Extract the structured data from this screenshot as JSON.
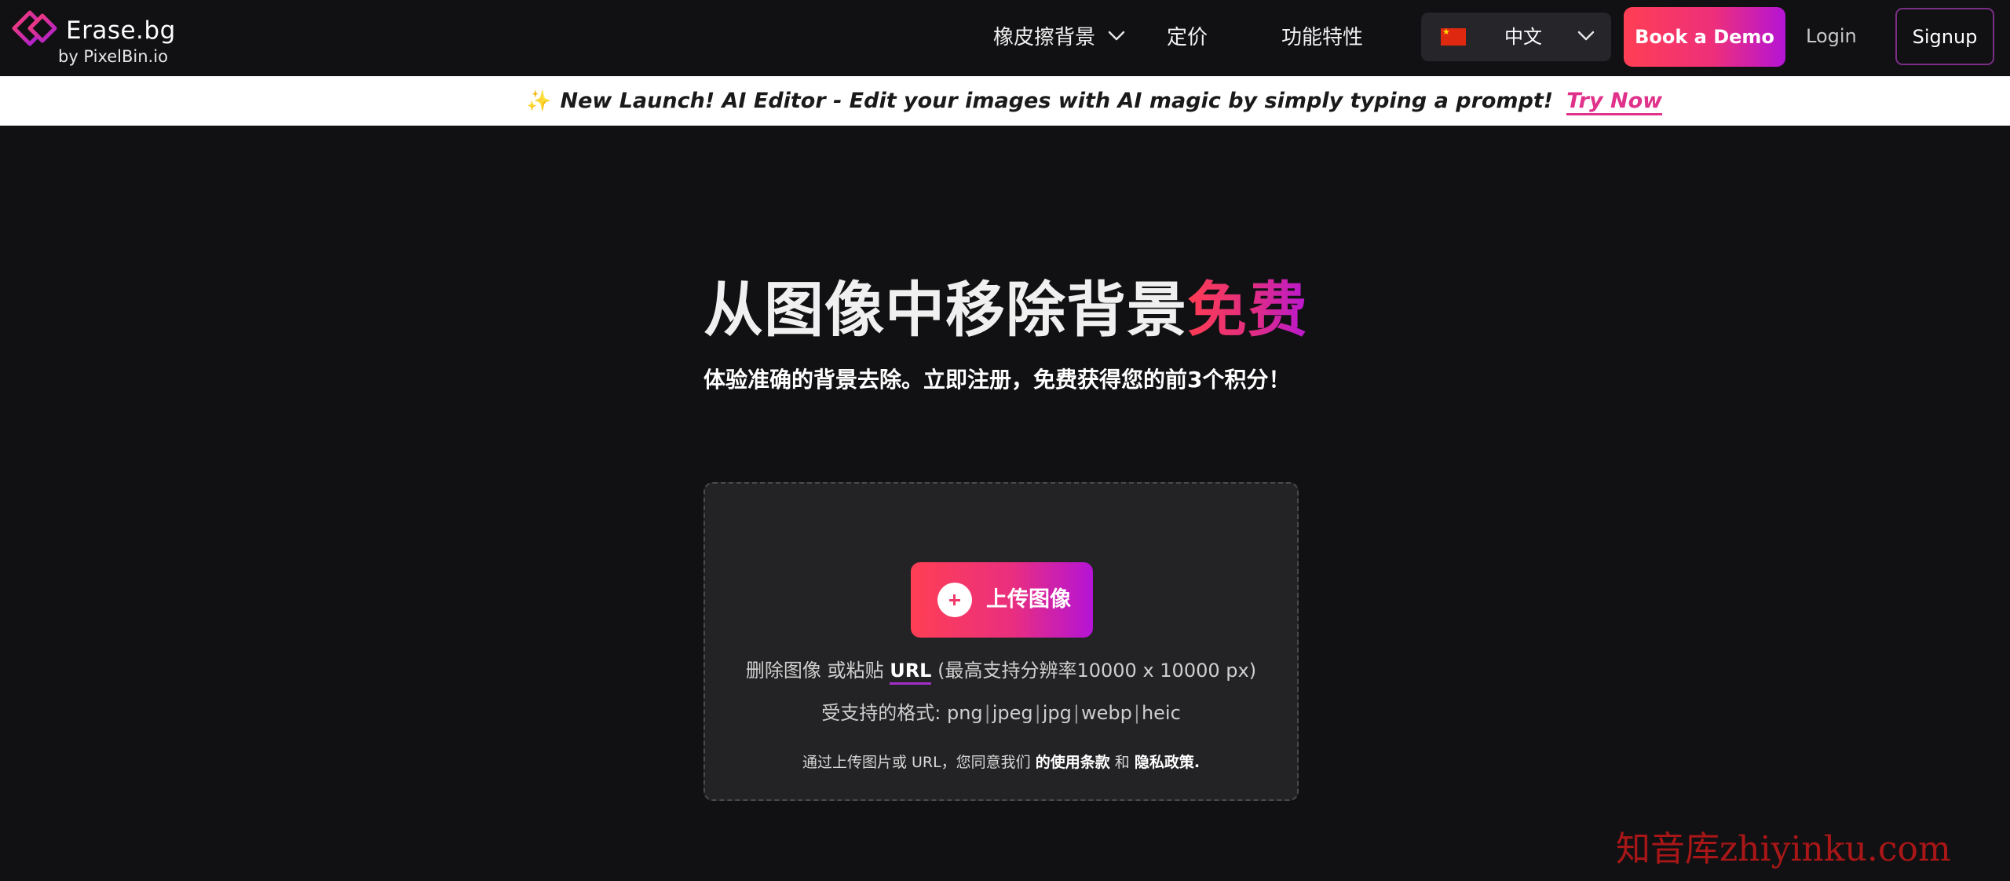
{
  "header": {
    "logo": {
      "name": "Erase.bg",
      "sub": "by PixelBin.io",
      "icon": "erasebg-logo-icon"
    },
    "nav": [
      {
        "label": "橡皮擦背景",
        "has_dropdown": true
      },
      {
        "label": "定价",
        "has_dropdown": false
      },
      {
        "label": "功能特性",
        "has_dropdown": false
      }
    ],
    "language": {
      "label": "中文",
      "flag": "china-flag-icon"
    },
    "demo_label": "Book a Demo",
    "login_label": "Login",
    "signup_label": "Signup"
  },
  "banner": {
    "icon": "sparkles-icon",
    "text": "New Launch! AI Editor - Edit your images with AI magic by simply typing a prompt!",
    "link_label": "Try Now"
  },
  "hero": {
    "title_main": "从图像中移除背景",
    "title_accent": "免费",
    "subtitle": "体验准确的背景去除。立即注册，免费获得您的前3个积分！"
  },
  "upload": {
    "button_label": "上传图像",
    "button_icon": "plus-circle-icon",
    "drop_prefix": "删除图像 或粘贴",
    "drop_link": "URL",
    "drop_suffix": "(最高支持分辨率10000 x 10000 px)",
    "formats_label": "受支持的格式:",
    "formats": [
      "png",
      "jpeg",
      "jpg",
      "webp",
      "heic"
    ],
    "terms_prefix": "通过上传图片或 URL，您同意我们",
    "terms_link": "的使用条款",
    "terms_and": "和",
    "privacy_link": "隐私政策."
  },
  "watermark": "知音库zhiyinku.com",
  "colors": {
    "background": "#111113",
    "card": "#232325",
    "accent_start": "#ff3f54",
    "accent_end": "#b414d6",
    "banner_link": "#e0328a"
  }
}
